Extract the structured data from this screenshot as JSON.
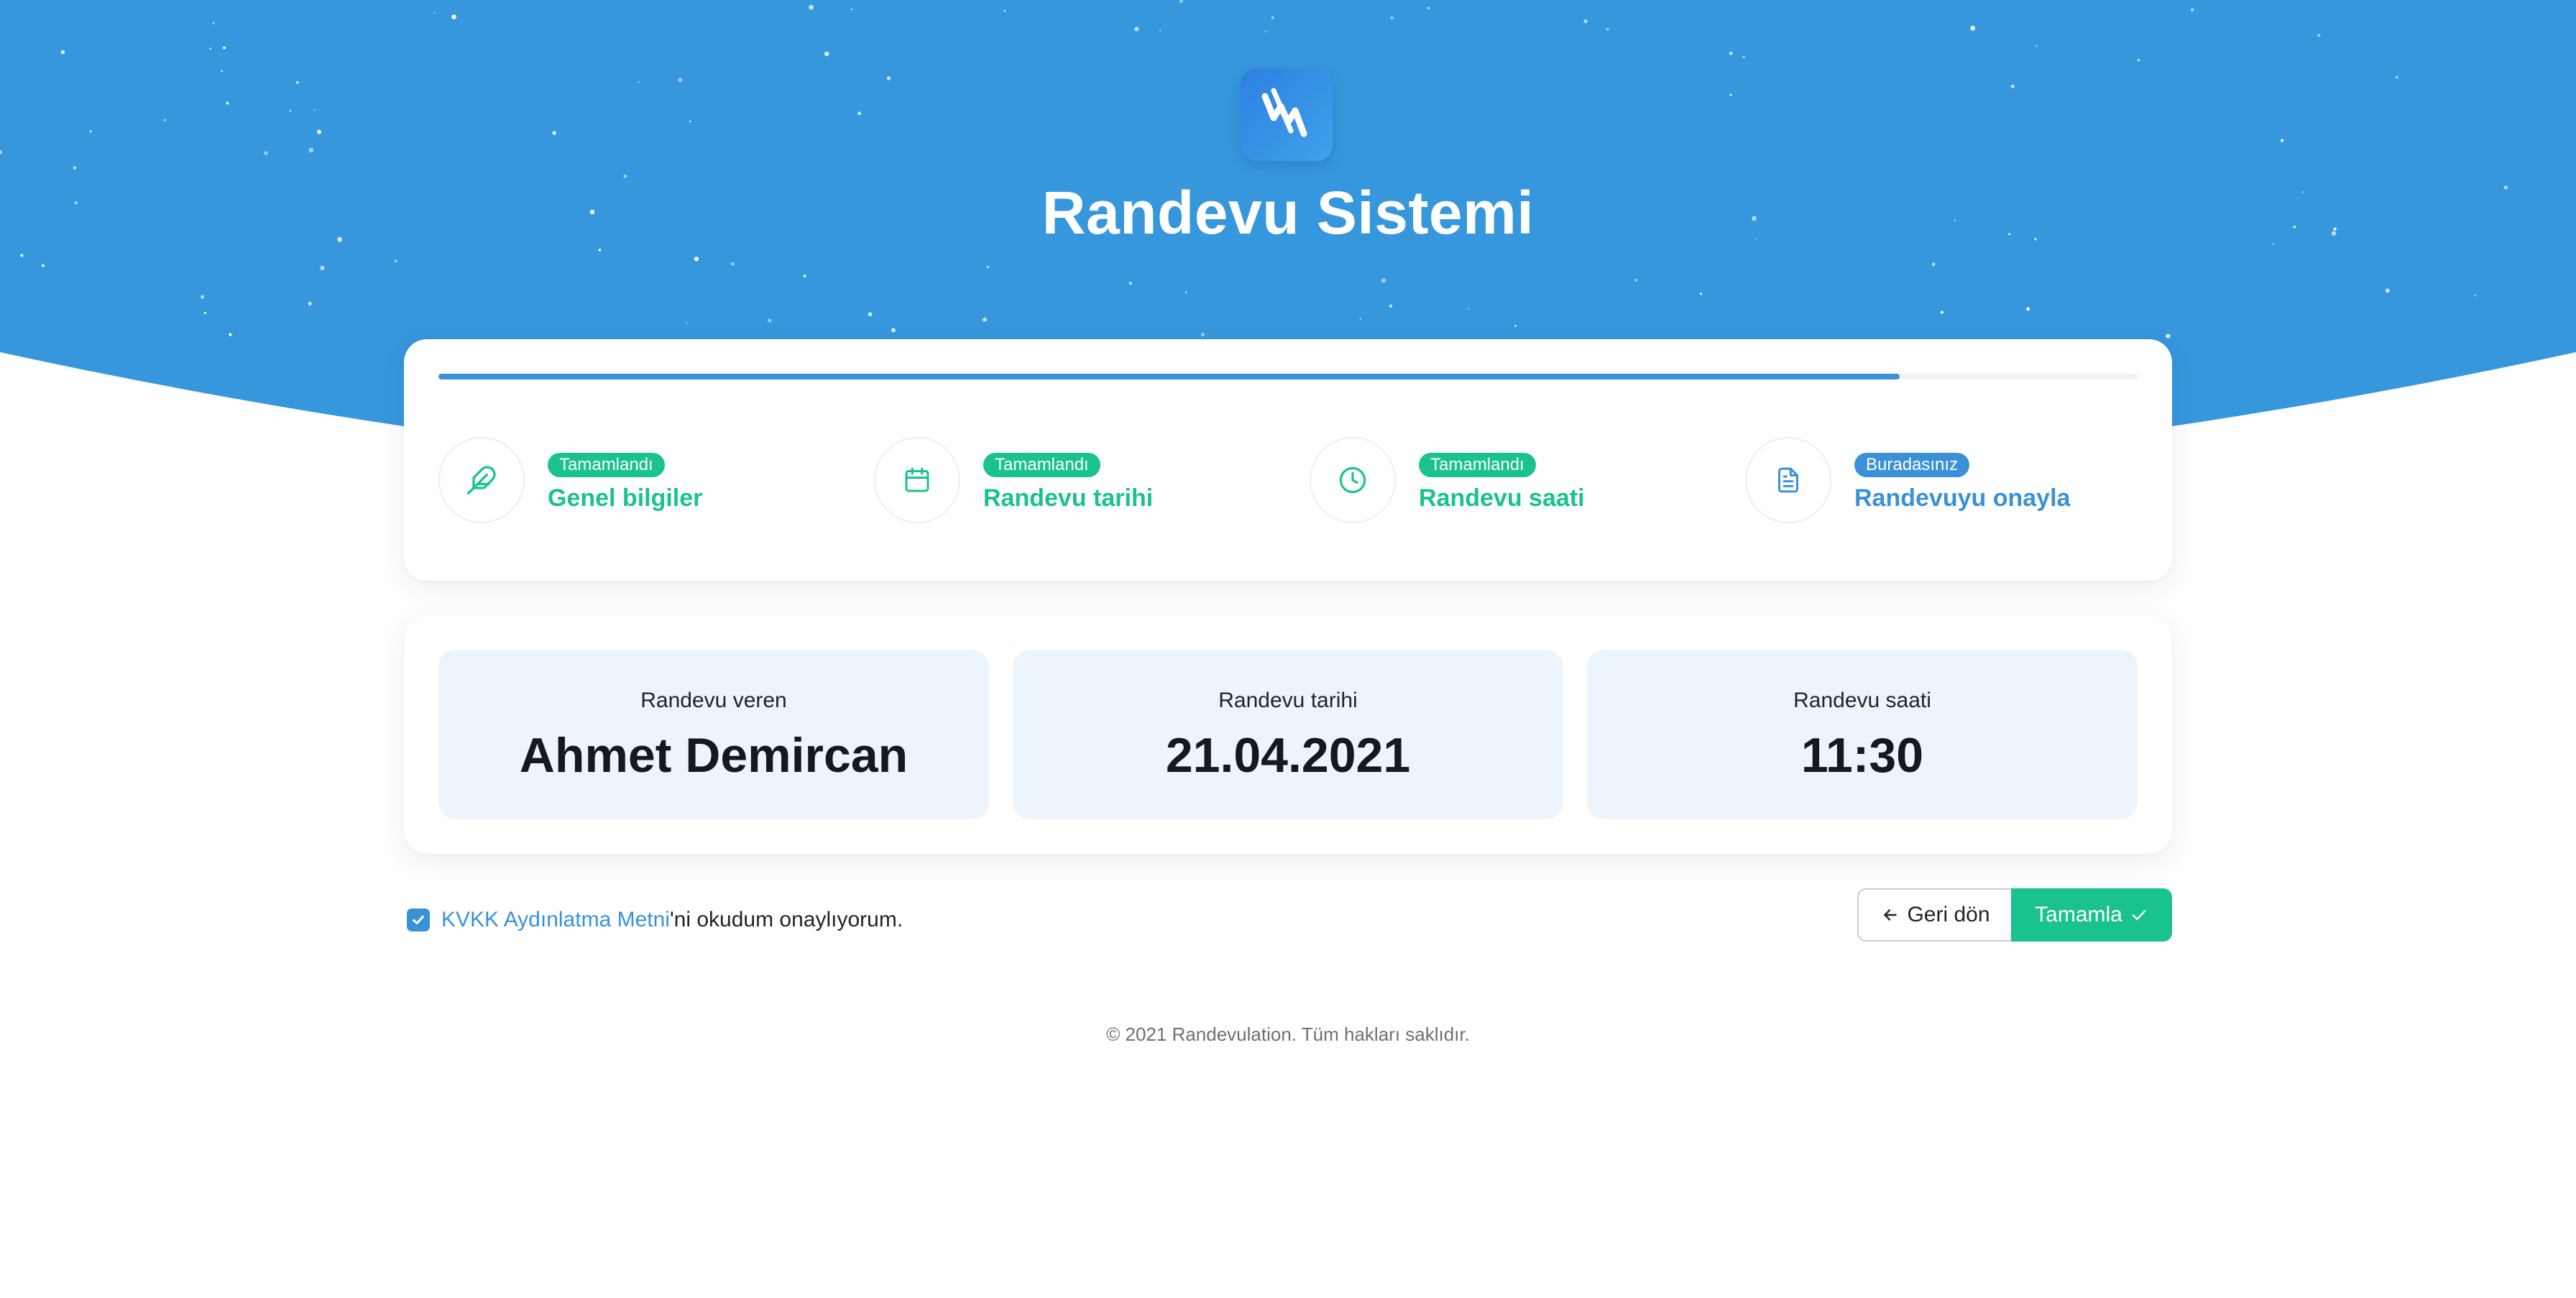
{
  "app": {
    "title": "Randevu Sistemi",
    "logo_icon": "app-logo-icon"
  },
  "colors": {
    "header_blue": "#3797dc",
    "primary": "#3a91d8",
    "success": "#19c28e",
    "tile_bg": "#edf5fc"
  },
  "progress": {
    "percent": 86
  },
  "steps": [
    {
      "badge": "Tamamlandı",
      "label": "Genel bilgiler",
      "status": "done",
      "icon": "feather-icon"
    },
    {
      "badge": "Tamamlandı",
      "label": "Randevu tarihi",
      "status": "done",
      "icon": "calendar-icon"
    },
    {
      "badge": "Tamamlandı",
      "label": "Randevu saati",
      "status": "done",
      "icon": "clock-icon"
    },
    {
      "badge": "Buradasınız",
      "label": "Randevuyu onayla",
      "status": "current",
      "icon": "document-icon"
    }
  ],
  "summary": [
    {
      "label": "Randevu veren",
      "value": "Ahmet Demircan"
    },
    {
      "label": "Randevu tarihi",
      "value": "21.04.2021"
    },
    {
      "label": "Randevu saati",
      "value": "11:30"
    }
  ],
  "consent": {
    "checked": true,
    "link_text": "KVKK Aydınlatma Metni",
    "rest_text": "'ni okudum onaylıyorum."
  },
  "actions": {
    "back_label": "Geri dön",
    "complete_label": "Tamamla"
  },
  "footer": {
    "copyright": "© 2021 Randevulation. Tüm hakları saklıdır."
  }
}
